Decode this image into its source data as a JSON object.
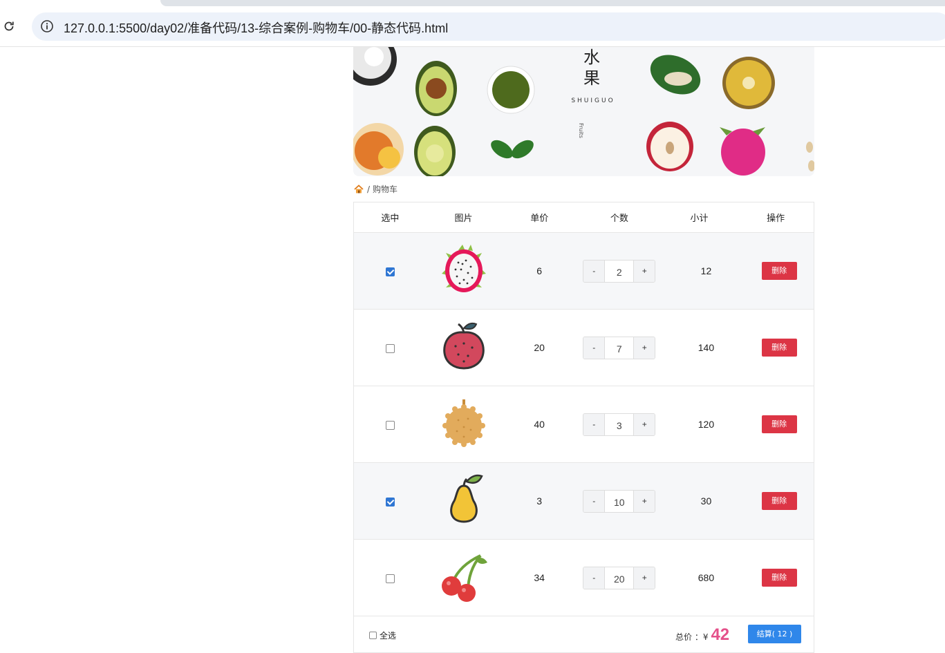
{
  "browser": {
    "url": "127.0.0.1:5500/day02/准备代码/13-综合案例-购物车/00-静态代码.html"
  },
  "banner": {
    "title_line1": "水",
    "title_line2": "果",
    "subtitle": "SHUIGUO",
    "vertical_text": "Fruits"
  },
  "breadcrumb": {
    "separator": "/",
    "current": "购物车"
  },
  "table": {
    "headers": [
      "选中",
      "图片",
      "单价",
      "个数",
      "小计",
      "操作"
    ],
    "minus_label": "-",
    "plus_label": "+",
    "delete_label": "删除",
    "rows": [
      {
        "fruit": "dragon-fruit",
        "checked": true,
        "price": "6",
        "qty": "2",
        "subtotal": "12"
      },
      {
        "fruit": "lychee",
        "checked": false,
        "price": "20",
        "qty": "7",
        "subtotal": "140"
      },
      {
        "fruit": "durian",
        "checked": false,
        "price": "40",
        "qty": "3",
        "subtotal": "120"
      },
      {
        "fruit": "pear",
        "checked": true,
        "price": "3",
        "qty": "10",
        "subtotal": "30"
      },
      {
        "fruit": "cherry",
        "checked": false,
        "price": "34",
        "qty": "20",
        "subtotal": "680"
      }
    ]
  },
  "footer": {
    "select_all_label": "全选",
    "total_label": "总价 ：¥",
    "total_amount": "42",
    "checkout_label": "结算( 12 )"
  },
  "colors": {
    "delete": "#dc3545",
    "checkout": "#2f87ea",
    "total": "#e4508a",
    "checkbox": "#2f76d3"
  }
}
